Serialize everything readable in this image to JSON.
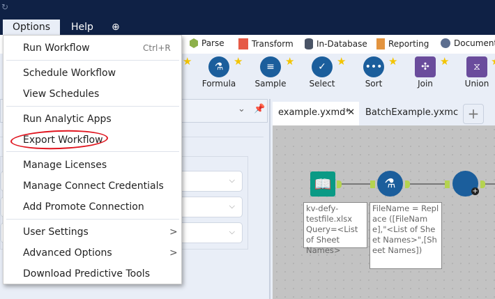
{
  "menubar": {
    "refresh_icon": "↻",
    "items": [
      {
        "label": "Options"
      },
      {
        "label": "Help"
      }
    ],
    "globe_icon": "globe-icon"
  },
  "categories": [
    {
      "label": "Parse",
      "color": "#8db04a"
    },
    {
      "label": "Transform",
      "color": "#e65a46"
    },
    {
      "label": "In-Database",
      "color": "#4a5466"
    },
    {
      "label": "Reporting",
      "color": "#e3943f"
    },
    {
      "label": "Documenta",
      "color": "#5c6e8f"
    }
  ],
  "tools": [
    {
      "label": "Formula"
    },
    {
      "label": "Sample"
    },
    {
      "label": "Select"
    },
    {
      "label": "Sort"
    },
    {
      "label": "Join"
    },
    {
      "label": "Union"
    }
  ],
  "tabs": [
    {
      "label": "example.yxmd*",
      "active": true
    },
    {
      "label": "BatchExample.yxmc",
      "active": false
    }
  ],
  "tab_add": "+",
  "canvas": {
    "input_note": "kv-defy-testfile.xlsx Query=<List of Sheet Names>",
    "formula_note": "FileName = Replace ([FileName],\"<List of Sheet Names>\",[Sheet Names])"
  },
  "dropdown": {
    "items": [
      {
        "label": "Run Workflow",
        "shortcut": "Ctrl+R"
      },
      {
        "label": "Schedule Workflow"
      },
      {
        "label": "View Schedules"
      },
      {
        "label": "Run Analytic Apps"
      },
      {
        "label": "Export Workflow",
        "highlighted_annotation": "red circle"
      },
      {
        "label": "Manage Licenses"
      },
      {
        "label": "Manage Connect Credentials"
      },
      {
        "label": "Add Promote Connection"
      },
      {
        "label": "User Settings",
        "submenu": ">"
      },
      {
        "label": "Advanced Options",
        "submenu": ">"
      },
      {
        "label": "Download Predictive Tools"
      }
    ]
  }
}
